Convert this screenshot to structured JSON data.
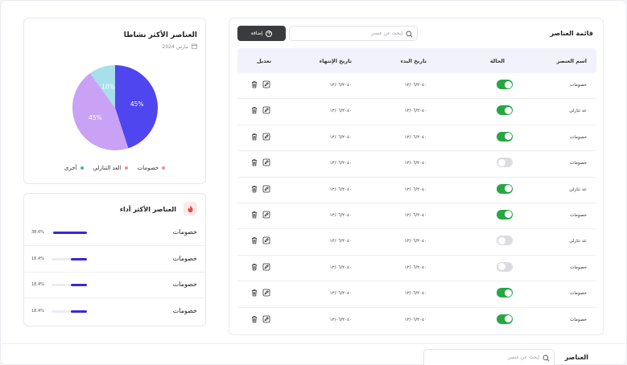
{
  "list": {
    "title": "قائمة العناصر",
    "search_placeholder": "إبحث عن عنصر",
    "add_label": "إضافة",
    "headers": {
      "name": "اسم العنصر",
      "status": "الحالة",
      "start": "تاريخ البدء",
      "end": "تاريخ الإنتهاء",
      "edit": "تعديل"
    },
    "rows": [
      {
        "name": "خصومات",
        "on": true,
        "start": "١٢/٠٦/٢٠٤٠",
        "end": "١٢/٠٦/٢٠٤٠"
      },
      {
        "name": "عد تنازلي",
        "on": true,
        "start": "١٢/٠٦/٢٠٤٠",
        "end": "١٢/٠٦/٢٠٤٠"
      },
      {
        "name": "خصومات",
        "on": true,
        "start": "١٢/٠٦/٢٠٤٠",
        "end": "١٢/٠٦/٢٠٤٠"
      },
      {
        "name": "خصومات",
        "on": false,
        "start": "١٢/٠٦/٢٠٤٠",
        "end": "١٢/٠٦/٢٠٤٠"
      },
      {
        "name": "عد تنازلي",
        "on": true,
        "start": "١٢/٠٦/٢٠٤٠",
        "end": "١٢/٠٦/٢٠٤٠"
      },
      {
        "name": "خصومات",
        "on": true,
        "start": "١٢/٠٦/٢٠٤٠",
        "end": "١٢/٠٦/٢٠٤٠"
      },
      {
        "name": "عد تنازلي",
        "on": false,
        "start": "١٢/٠٦/٢٠٤٠",
        "end": "١٢/٠٦/٢٠٤٠"
      },
      {
        "name": "خصومات",
        "on": false,
        "start": "١٢/٠٦/٢٠٤٠",
        "end": "١٢/٠٦/٢٠٤٠"
      },
      {
        "name": "خصومات",
        "on": true,
        "start": "١٢/٠٦/٢٠٤٠",
        "end": "١٢/٠٦/٢٠٤٠"
      },
      {
        "name": "خصومات",
        "on": true,
        "start": "١٢/٠٦/٢٠٤٠",
        "end": "١٢/٠٦/٢٠٤٠"
      }
    ]
  },
  "active": {
    "title": "العناصر الأكثر نشاطا",
    "date": "مارس 2024"
  },
  "chart_data": {
    "type": "pie",
    "slices": [
      {
        "label": "خصومات",
        "value": 45,
        "display": "45%",
        "color": "#4f46f0"
      },
      {
        "label": "العد التنازلي",
        "value": 45,
        "display": "45%",
        "color": "#c9a2f5"
      },
      {
        "label": "أخرى",
        "value": 10,
        "display": "10%",
        "color": "#a7dfea"
      }
    ],
    "legend": [
      {
        "label": "خصومات",
        "color": "#f48a9a"
      },
      {
        "label": "العد التنازلي",
        "color": "#f48a9a"
      },
      {
        "label": "أخرى",
        "color": "#3cc08a"
      }
    ]
  },
  "performance": {
    "title": "العناصر الأكثر أداء",
    "rows": [
      {
        "label": "خصومات",
        "pct": "38.6%",
        "value": 38.6
      },
      {
        "label": "خصومات",
        "pct": "18.4%",
        "value": 18.4
      },
      {
        "label": "خصومات",
        "pct": "18.4%",
        "value": 18.4
      },
      {
        "label": "خصومات",
        "pct": "18.4%",
        "value": 18.4
      }
    ]
  },
  "bottom": {
    "title": "العناصر",
    "search_placeholder": "إبحث عن عنصر"
  },
  "colors": {
    "toggle_on": "#27a744",
    "toggle_off": "#dcdce0",
    "bar_fill": "#3a28d6",
    "add_button": "#3a3b3f",
    "header_bg": "#f1f2fb"
  }
}
